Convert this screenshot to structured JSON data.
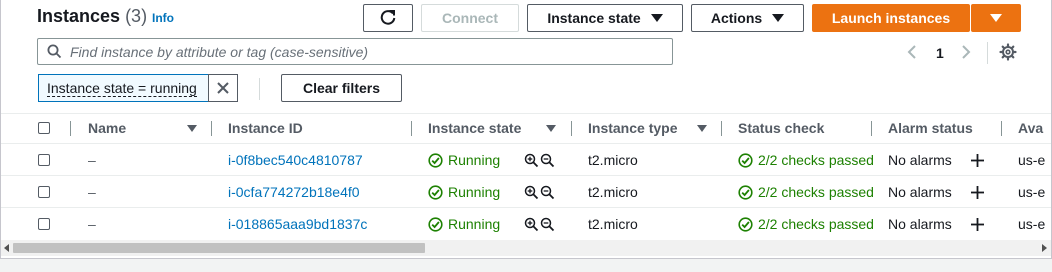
{
  "header": {
    "title": "Instances",
    "count": "(3)",
    "info_label": "Info",
    "connect_label": "Connect",
    "instance_state_label": "Instance state",
    "actions_label": "Actions",
    "launch_label": "Launch instances"
  },
  "search": {
    "placeholder": "Find instance by attribute or tag (case-sensitive)"
  },
  "filter": {
    "chip_label": "Instance state = running",
    "clear_label": "Clear filters"
  },
  "pagination": {
    "current_page": "1"
  },
  "table": {
    "columns": [
      "Name",
      "Instance ID",
      "Instance state",
      "Instance type",
      "Status check",
      "Alarm status",
      "Ava"
    ],
    "rows": [
      {
        "name": "–",
        "instance_id": "i-0f8bec540c4810787",
        "state": "Running",
        "type": "t2.micro",
        "status_check": "2/2 checks passed",
        "alarm": "No alarms",
        "az": "us-e"
      },
      {
        "name": "–",
        "instance_id": "i-0cfa774272b18e4f0",
        "state": "Running",
        "type": "t2.micro",
        "status_check": "2/2 checks passed",
        "alarm": "No alarms",
        "az": "us-e"
      },
      {
        "name": "–",
        "instance_id": "i-018865aaa9bd1837c",
        "state": "Running",
        "type": "t2.micro",
        "status_check": "2/2 checks passed",
        "alarm": "No alarms",
        "az": "us-e"
      }
    ]
  },
  "colors": {
    "primary": "#ec7211",
    "link": "#0073bb",
    "success": "#1d8102"
  }
}
